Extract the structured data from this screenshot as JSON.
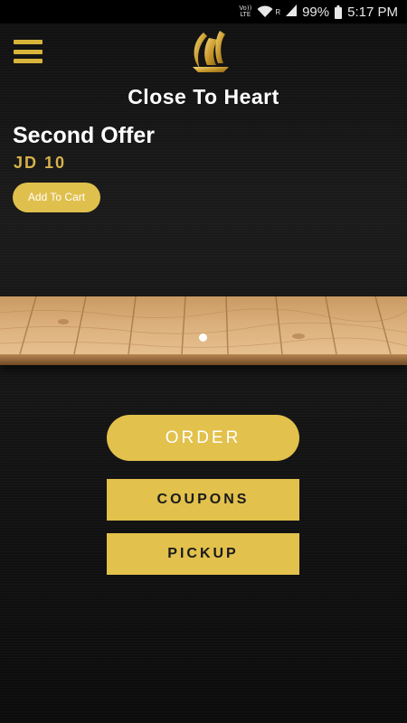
{
  "status_bar": {
    "volte_top": "Vo))",
    "volte_bottom": "LTE",
    "signal_label": "R",
    "battery_percent": "99%",
    "time": "5:17 PM"
  },
  "header": {
    "title": "Close To Heart",
    "menu_icon": "hamburger-menu-icon",
    "logo_icon": "sailboat-logo-icon"
  },
  "offer": {
    "title": "Second Offer",
    "price": "JD 10",
    "add_to_cart_label": "Add To Cart"
  },
  "carousel": {
    "pages": 1,
    "active_index": 0
  },
  "actions": {
    "order_label": "ORDER",
    "coupons_label": "COUPONS",
    "pickup_label": "PICKUP"
  },
  "colors": {
    "accent": "#e2c14c",
    "price": "#d6b24a",
    "background": "#141414",
    "wood": "#d9a872"
  }
}
